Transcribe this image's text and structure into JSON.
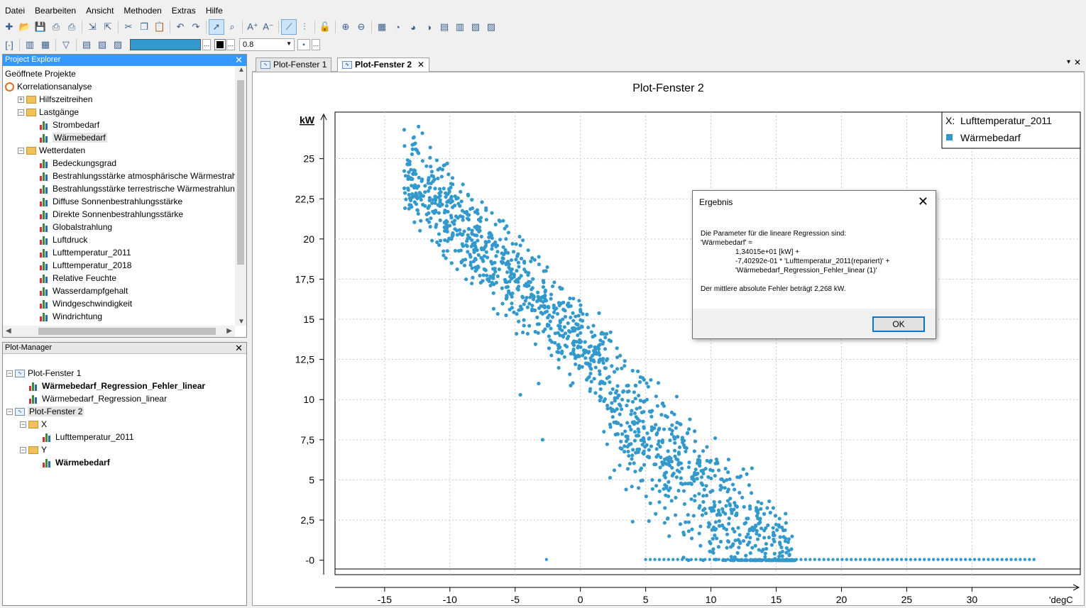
{
  "menu": [
    "Datei",
    "Bearbeiten",
    "Ansicht",
    "Methoden",
    "Extras",
    "Hilfe"
  ],
  "toolbar": {
    "icons1": [
      "new-icon",
      "open-icon",
      "save-icon",
      "print-preview-icon",
      "print-icon",
      "sep",
      "import-icon",
      "export-icon",
      "sep",
      "cut-icon",
      "copy-icon",
      "paste-icon",
      "sep",
      "undo-icon",
      "redo-icon",
      "sep",
      "pointer-icon",
      "zoom-select-icon",
      "sep",
      "font-larger-icon",
      "font-smaller-icon",
      "sep",
      "chart-tool-icon",
      "marker-tool-icon",
      "sep",
      "lock-icon",
      "sep",
      "zoom-in-icon",
      "zoom-out-icon",
      "sep",
      "table-icon",
      "pie-icon",
      "pie2-icon",
      "pie3-icon",
      "grid-icon",
      "grid2-icon",
      "grid3-icon",
      "grid4-icon"
    ],
    "active1": [
      "pointer-icon",
      "chart-tool-icon"
    ],
    "icons2": [
      "select-frame-icon",
      "sep",
      "chart-edit-icon",
      "chart-add-icon",
      "sep",
      "filter-icon",
      "sep",
      "hatch-icon",
      "hatch2-icon",
      "hatch3-icon"
    ],
    "line_color": "#3399cc",
    "line_width": "0.8"
  },
  "project_explorer": {
    "title": "Project Explorer",
    "root": "Geöffnete Projekte",
    "project": "Korrelationsanalyse",
    "items": [
      {
        "label": "Hilfszeitreihen",
        "type": "folder",
        "level": 1,
        "expander": "+"
      },
      {
        "label": "Lastgänge",
        "type": "folder",
        "level": 1,
        "expander": "-"
      },
      {
        "label": "Strombedarf",
        "type": "series",
        "level": 2
      },
      {
        "label": "Wärmebedarf",
        "type": "series",
        "level": 2,
        "selected": true
      },
      {
        "label": "Wetterdaten",
        "type": "folder",
        "level": 1,
        "expander": "-"
      },
      {
        "label": "Bedeckungsgrad",
        "type": "series",
        "level": 2
      },
      {
        "label": "Bestrahlungsstärke atmosphärische Wärmestrahlur",
        "type": "series",
        "level": 2
      },
      {
        "label": "Bestrahlungsstärke terrestrische Wärmestrahlung",
        "type": "series",
        "level": 2
      },
      {
        "label": "Diffuse Sonnenbestrahlungsstärke",
        "type": "series",
        "level": 2
      },
      {
        "label": "Direkte Sonnenbestrahlungsstärke",
        "type": "series",
        "level": 2
      },
      {
        "label": "Globalstrahlung",
        "type": "series",
        "level": 2
      },
      {
        "label": "Luftdruck",
        "type": "series",
        "level": 2
      },
      {
        "label": "Lufttemperatur_2011",
        "type": "series",
        "level": 2
      },
      {
        "label": "Lufttemperatur_2018",
        "type": "series",
        "level": 2
      },
      {
        "label": "Relative Feuchte",
        "type": "series",
        "level": 2
      },
      {
        "label": "Wasserdampfgehalt",
        "type": "series",
        "level": 2
      },
      {
        "label": "Windgeschwindigkeit",
        "type": "series",
        "level": 2
      },
      {
        "label": "Windrichtung",
        "type": "series",
        "level": 2
      }
    ]
  },
  "plot_manager": {
    "title": "Plot-Manager",
    "items": [
      {
        "label": "Plot-Fenster 1",
        "type": "plot",
        "level": 0,
        "expander": "-"
      },
      {
        "label": "Wärmebedarf_Regression_Fehler_linear",
        "type": "series",
        "level": 1,
        "bold": true
      },
      {
        "label": "Wärmebedarf_Regression_linear",
        "type": "series",
        "level": 1
      },
      {
        "label": "Plot-Fenster 2",
        "type": "plot",
        "level": 0,
        "expander": "-",
        "selected": true
      },
      {
        "label": "X",
        "type": "folder",
        "level": 1,
        "expander": "-"
      },
      {
        "label": "Lufttemperatur_2011",
        "type": "series",
        "level": 2
      },
      {
        "label": "Y",
        "type": "folder",
        "level": 1,
        "expander": "-"
      },
      {
        "label": "Wärmebedarf",
        "type": "series",
        "level": 2,
        "bold": true
      }
    ]
  },
  "tabs": [
    {
      "label": "Plot-Fenster 1",
      "selected": false
    },
    {
      "label": "Plot-Fenster 2",
      "selected": true
    }
  ],
  "tab_close": "✕",
  "tab_menu_icons": [
    "▾",
    "✕"
  ],
  "plot_title": "Plot-Fenster 2",
  "legend": {
    "x_label": "X:",
    "x_name": "Lufttemperatur_2011",
    "series_name": "Wärmebedarf",
    "series_color": "#3399cc"
  },
  "chart_data": {
    "type": "scatter",
    "title": "Plot-Fenster 2",
    "xlabel": "'degC",
    "ylabel": "kW",
    "xlim": [
      -18.8,
      38.3
    ],
    "ylim": [
      -0.9,
      27.9
    ],
    "xticks": [
      -15,
      -10,
      -5,
      0,
      5,
      10,
      15,
      20,
      25,
      30
    ],
    "xtick_labels": [
      "-15",
      "-10",
      "-5",
      "0",
      "5",
      "10",
      "15",
      "20",
      "25",
      "30"
    ],
    "yticks": [
      0,
      2.5,
      5,
      7.5,
      10,
      12.5,
      15,
      17.5,
      20,
      22.5,
      25
    ],
    "ytick_labels": [
      "-0",
      "2,5",
      "5",
      "7,5",
      "10",
      "12,5",
      "15",
      "17,5",
      "20",
      "22,5",
      "25"
    ],
    "grid": true,
    "legend_position": "top-right",
    "series": [
      {
        "name": "Wärmebedarf",
        "color": "#3399cc",
        "regression": {
          "intercept": 13.4015,
          "slope": -0.740292
        },
        "approx_points": [
          [
            -13.5,
            26.8
          ],
          [
            -12.4,
            27.0
          ],
          [
            -12.8,
            26.3
          ],
          [
            -11.5,
            25.7
          ],
          [
            -11.0,
            24.9
          ],
          [
            -10.4,
            24.6
          ],
          [
            -9.8,
            23.8
          ],
          [
            -9.0,
            23.4
          ],
          [
            -8.6,
            22.7
          ],
          [
            -7.9,
            21.8
          ],
          [
            -7.2,
            21.2
          ],
          [
            -6.5,
            20.9
          ],
          [
            -5.7,
            20.0
          ],
          [
            -5.2,
            19.7
          ],
          [
            -4.6,
            19.6
          ],
          [
            -4.0,
            19.3
          ],
          [
            -3.5,
            18.7
          ],
          [
            -2.8,
            18.0
          ],
          [
            -2.0,
            17.3
          ],
          [
            -1.5,
            16.9
          ],
          [
            -0.8,
            16.3
          ],
          [
            0.0,
            15.6
          ],
          [
            0.5,
            15.3
          ],
          [
            1.0,
            14.6
          ],
          [
            1.6,
            14.1
          ],
          [
            2.2,
            13.7
          ],
          [
            2.8,
            13.2
          ],
          [
            3.4,
            12.4
          ],
          [
            4.0,
            11.8
          ],
          [
            4.6,
            11.4
          ],
          [
            5.2,
            10.8
          ],
          [
            5.8,
            10.2
          ],
          [
            6.4,
            9.6
          ],
          [
            7.0,
            9.2
          ],
          [
            7.6,
            8.5
          ],
          [
            8.2,
            7.9
          ],
          [
            8.8,
            7.4
          ],
          [
            9.4,
            6.8
          ],
          [
            10.0,
            6.2
          ],
          [
            10.6,
            5.6
          ],
          [
            11.2,
            5.0
          ],
          [
            11.8,
            4.4
          ],
          [
            12.4,
            3.9
          ],
          [
            13.0,
            3.2
          ],
          [
            13.6,
            2.6
          ],
          [
            14.2,
            2.0
          ],
          [
            14.8,
            1.3
          ],
          [
            15.4,
            0.8
          ],
          [
            16.0,
            0.3
          ],
          [
            -4.9,
            14.1
          ],
          [
            -3.2,
            11.0
          ],
          [
            -2.9,
            7.5
          ],
          [
            -4.6,
            10.3
          ],
          [
            -1.0,
            13.8
          ],
          [
            1.8,
            8.0
          ],
          [
            2.6,
            5.6
          ],
          [
            3.5,
            4.4
          ],
          [
            4.0,
            2.4
          ],
          [
            5.5,
            5.0
          ],
          [
            6.8,
            1.5
          ],
          [
            8.5,
            3.8
          ],
          [
            9.2,
            0.9
          ],
          [
            11.0,
            2.0
          ],
          [
            12.5,
            1.2
          ]
        ],
        "zero_band": {
          "x_from": 5,
          "x_to": 35,
          "y": 0
        }
      }
    ]
  },
  "dialog": {
    "title": "Ergebnis",
    "close": "✕",
    "lines": [
      "Die Parameter für die lineare Regression sind:",
      "'Wärmebedarf' ="
    ],
    "indented": [
      "1,34015e+01 [kW] +",
      "-7,40292e-01 * 'Lufttemperatur_2011(repariert)' +",
      "'Wärmebedarf_Regression_Fehler_linear (1)'"
    ],
    "footer": "Der mittlere absolute Fehler beträgt 2,268 kW.",
    "ok_label": "OK"
  }
}
